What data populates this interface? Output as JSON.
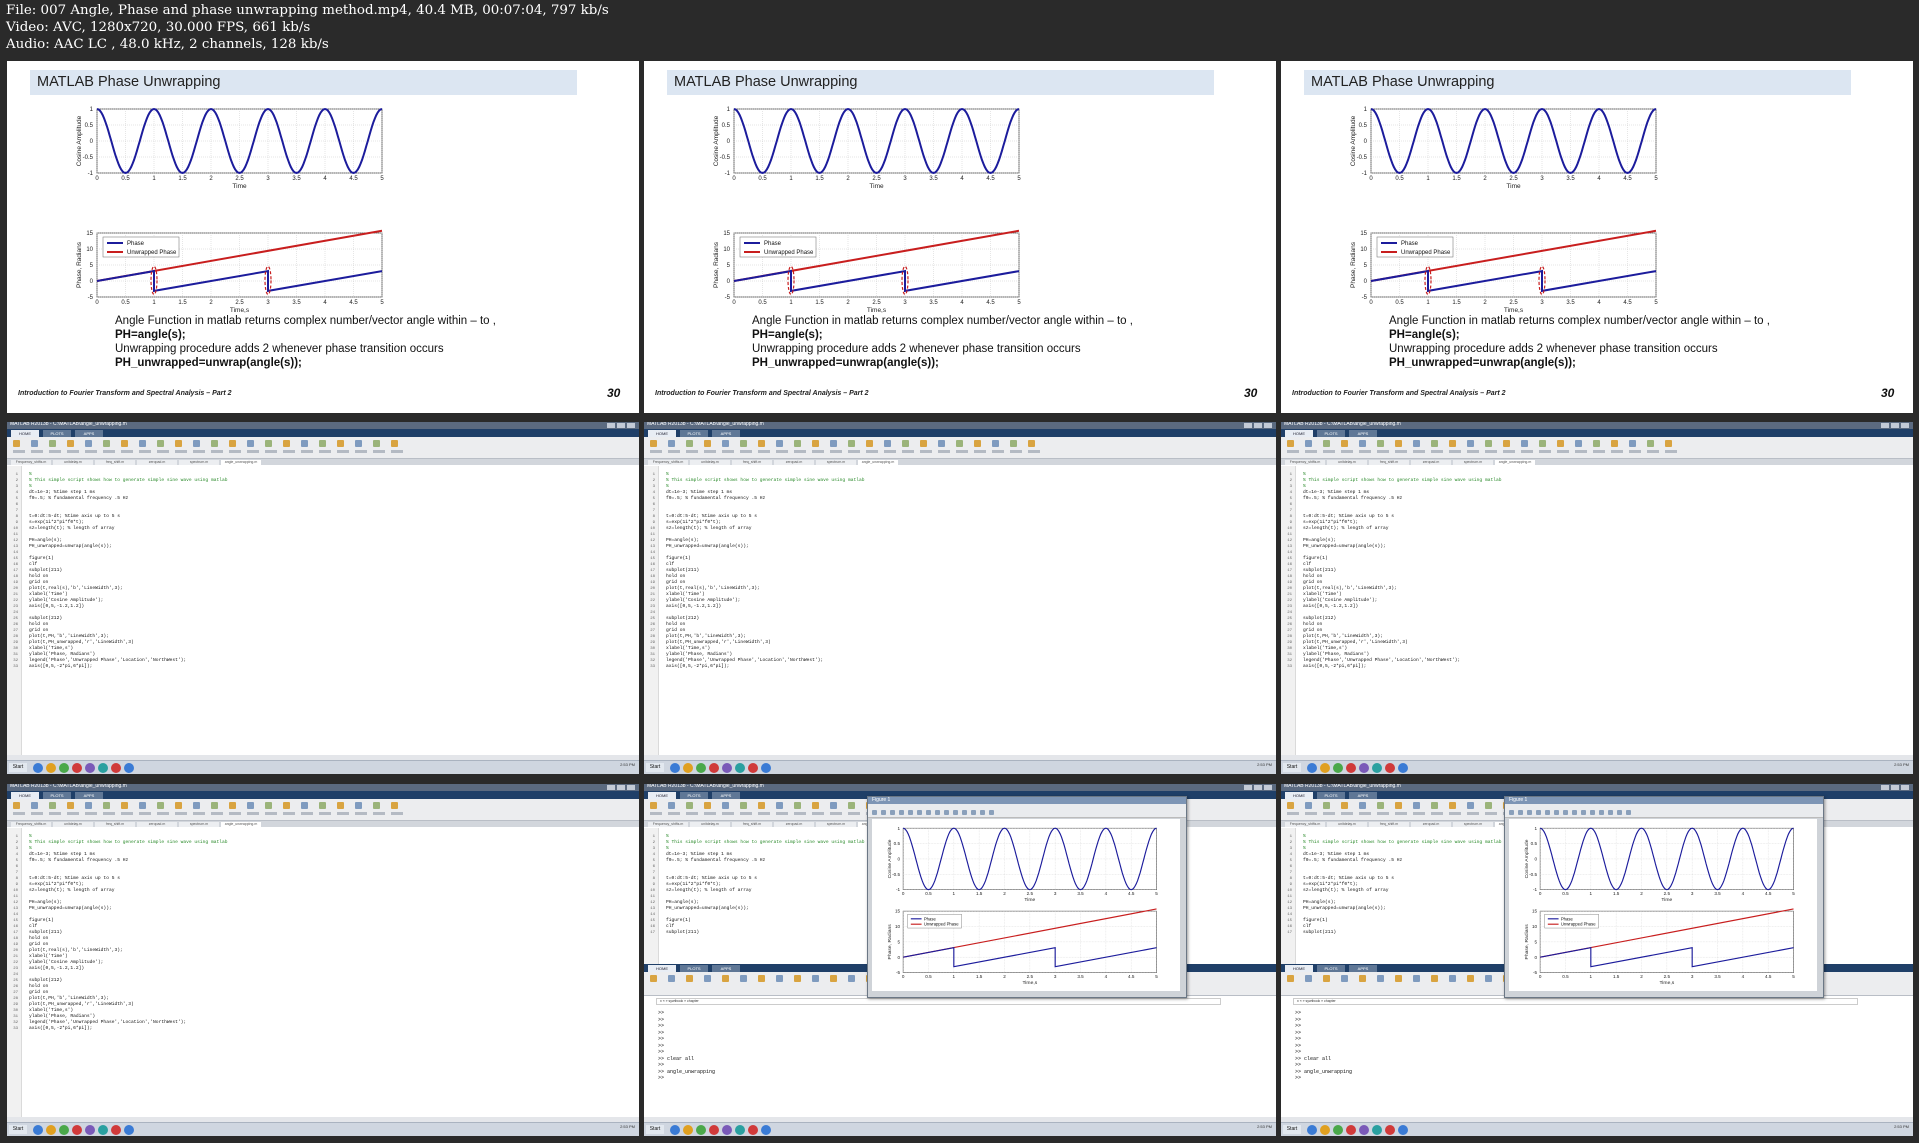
{
  "header": {
    "line1": "File: 007 Angle, Phase and phase unwrapping method.mp4, 40.4 MB, 00:07:04, 797 kb/s",
    "line2": "Video: AVC, 1280x720, 30.000 FPS, 661 kb/s",
    "line3": "Audio: AAC LC , 48.0 kHz, 2 channels, 128 kb/s"
  },
  "slide": {
    "title": "MATLAB Phase Unwrapping",
    "top_plot": {
      "ylabel": "Cosine Amplitude",
      "xlabel": "Time",
      "xticks": [
        "0",
        "0.5",
        "1",
        "1.5",
        "2",
        "2.5",
        "3",
        "3.5",
        "4",
        "4.5",
        "5"
      ],
      "yticks": [
        "1",
        "0.5",
        "0",
        "-0.5",
        "-1"
      ]
    },
    "bottom_plot": {
      "ylabel": "Phase, Radians",
      "xlabel": "Time,s",
      "xticks": [
        "0",
        "0.5",
        "1",
        "1.5",
        "2",
        "2.5",
        "3",
        "3.5",
        "4",
        "4.5",
        "5"
      ],
      "yticks": [
        "15",
        "10",
        "5",
        "0",
        "-5"
      ],
      "legend": [
        "Phase",
        "Unwrapped Phase"
      ]
    },
    "caption": [
      "Angle Function in matlab returns complex number/vector angle within – to  ,",
      "PH=angle(s);",
      "Unwrapping procedure adds 2  whenever phase transition occurs",
      "PH_unwrapped=unwrap(angle(s));"
    ],
    "footer": "Introduction to Fourier Transform and Spectral Analysis – Part 2",
    "page_number": "30"
  },
  "chart_data": [
    {
      "type": "line",
      "xlabel": "Time",
      "ylabel": "Cosine Amplitude",
      "xlim": [
        0,
        5
      ],
      "ylim": [
        -1,
        1
      ],
      "grid": true,
      "series": [
        {
          "x": [
            0,
            0.25,
            0.5,
            0.75,
            1,
            1.25,
            1.5,
            1.75,
            2,
            2.25,
            2.5,
            2.75,
            3,
            3.25,
            3.5,
            3.75,
            4,
            4.25,
            4.5,
            4.75,
            5
          ],
          "y": [
            1,
            0,
            -1,
            0,
            1,
            0,
            -1,
            0,
            1,
            0,
            -1,
            0,
            1,
            0,
            -1,
            0,
            1,
            0,
            -1,
            0,
            1
          ]
        }
      ]
    },
    {
      "type": "line",
      "xlabel": "Time,s",
      "ylabel": "Phase, Radians",
      "xlim": [
        0,
        5
      ],
      "ylim": [
        -5,
        15
      ],
      "grid": true,
      "legend": "top-left",
      "series": [
        {
          "name": "Phase",
          "color": "#1c1c9c",
          "x": [
            0,
            1,
            1,
            3,
            3,
            5
          ],
          "y": [
            0,
            3.1,
            -3.1,
            3.1,
            -3.1,
            3.1
          ]
        },
        {
          "name": "Unwrapped Phase",
          "color": "#c81e1e",
          "x": [
            0,
            5
          ],
          "y": [
            0,
            15.7
          ]
        }
      ]
    }
  ],
  "matlab": {
    "titlebar": "MATLAB R2013b - C:\\MATLAB\\angle_unwrapping.m",
    "tabs": [
      "HOME",
      "PLOTS",
      "APPS"
    ],
    "editor_tabs": [
      "Frequency_shifts.m",
      "unitdelay.m",
      "freq_shift.m",
      "zeropad.m",
      "spectrum.m",
      "angle_unwrapping.m"
    ],
    "start": "Start",
    "clock": "2:53 PM",
    "code_lines": [
      {
        "t": "%",
        "k": "c"
      },
      {
        "t": "% This simple script shows how to generate simple sine wave using matlab",
        "k": "c"
      },
      {
        "t": "%",
        "k": "c"
      },
      {
        "t": "dt=1e-3; %time step 1 ms",
        "k": ""
      },
      {
        "t": "f0=.5; % fundamental frequency .5 Hz",
        "k": ""
      },
      {
        "t": "",
        "k": ""
      },
      {
        "t": "",
        "k": ""
      },
      {
        "t": "t=0:dt:5-dt; %time axis up to 5 s",
        "k": ""
      },
      {
        "t": "s=exp(1i*2*pi*f0*t);",
        "k": ""
      },
      {
        "t": "sz=length(t); % length of array",
        "k": ""
      },
      {
        "t": "",
        "k": ""
      },
      {
        "t": "PH=angle(s);",
        "k": ""
      },
      {
        "t": "PH_unwrapped=unwrap(angle(s));",
        "k": ""
      },
      {
        "t": "",
        "k": ""
      },
      {
        "t": "figure(1)",
        "k": ""
      },
      {
        "t": "clf",
        "k": ""
      },
      {
        "t": "subplot(211)",
        "k": ""
      },
      {
        "t": "hold on",
        "k": ""
      },
      {
        "t": "grid on",
        "k": ""
      },
      {
        "t": "plot(t,real(s),'b','LineWidth',3);",
        "k": ""
      },
      {
        "t": "xlabel('Time')",
        "k": ""
      },
      {
        "t": "ylabel('Cosine Amplitude');",
        "k": ""
      },
      {
        "t": "axis([0,5,-1.2,1.2])",
        "k": ""
      },
      {
        "t": "",
        "k": ""
      },
      {
        "t": "subplot(212)",
        "k": ""
      },
      {
        "t": "hold on",
        "k": ""
      },
      {
        "t": "grid on",
        "k": ""
      },
      {
        "t": "plot(t,PH,'b','LineWidth',3);",
        "k": ""
      },
      {
        "t": "plot(t,PH_unwrapped,'r','LineWidth',3)",
        "k": ""
      },
      {
        "t": "xlabel('Time,s')",
        "k": ""
      },
      {
        "t": "ylabel('Phase, Radians')",
        "k": ""
      },
      {
        "t": "legend('Phase','Unwrapped Phase','Location','NorthWest');",
        "k": ""
      },
      {
        "t": "axis([0,5,-2*pi,6*pi]);",
        "k": ""
      }
    ],
    "command_lines": [
      ">>",
      ">>",
      ">>",
      ">>",
      ">>",
      ">>",
      ">>",
      ">> clear all",
      ">>",
      ">> angle_unwrapping",
      ">>"
    ],
    "address": "x  «  »  sywtbook  »  chapter",
    "figure_title": "Figure 1"
  },
  "colors": {
    "slide_title_bg": "#dce6f2",
    "phase": "#1c1c9c",
    "unwrapped": "#c81e1e",
    "matlab_blue": "#1f3f68"
  }
}
